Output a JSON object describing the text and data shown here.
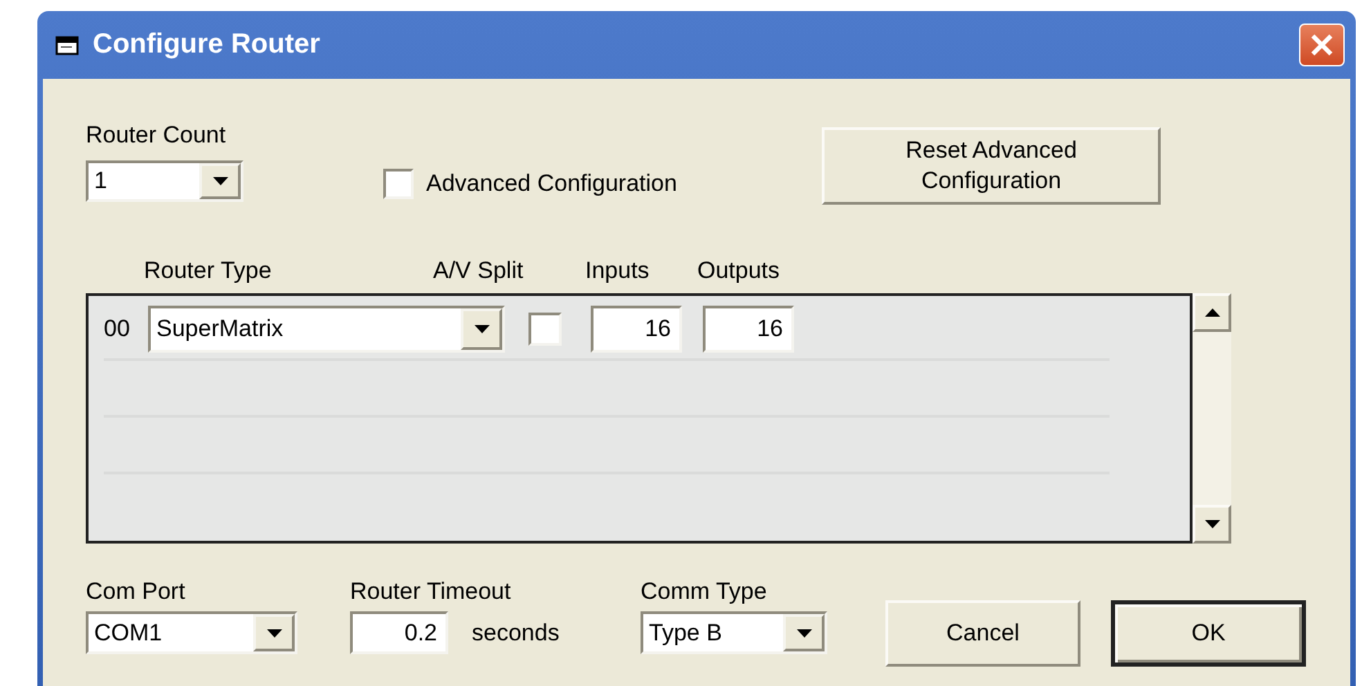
{
  "window": {
    "title": "Configure Router"
  },
  "router_count": {
    "label": "Router Count",
    "value": "1"
  },
  "advanced_configuration": {
    "label": "Advanced Configuration",
    "checked": false
  },
  "reset_button": {
    "label": "Reset Advanced Configuration"
  },
  "routers": {
    "columns": [
      "Router Type",
      "A/V Split",
      "Inputs",
      "Outputs"
    ],
    "rows": [
      {
        "index": "00",
        "router_type": "SuperMatrix",
        "av_split": false,
        "inputs": "16",
        "outputs": "16"
      }
    ]
  },
  "com_port": {
    "label": "Com Port",
    "value": "COM1"
  },
  "router_timeout": {
    "label": "Router Timeout",
    "value": "0.2",
    "unit": "seconds"
  },
  "comm_type": {
    "label": "Comm Type",
    "value": "Type B"
  },
  "buttons": [
    {
      "label": "Cancel",
      "default": false
    },
    {
      "label": "OK",
      "default": true
    }
  ]
}
